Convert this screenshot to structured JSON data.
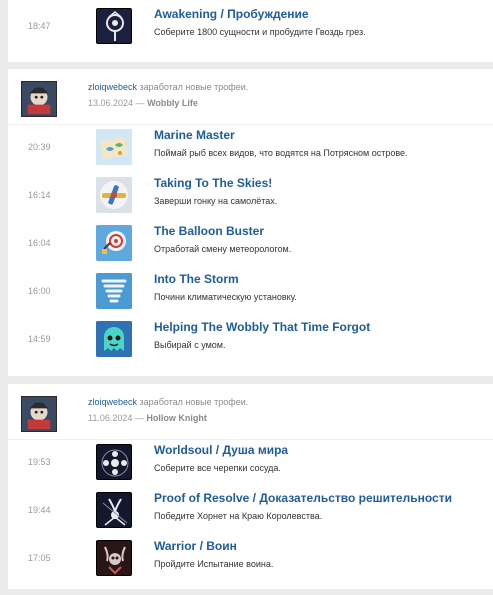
{
  "groups": [
    {
      "items": [
        {
          "time": "18:47",
          "title": "Awakening / Пробуждение",
          "description": "Соберите 1800 сущности и пробудите Гвоздь грез.",
          "icon": "awakening-trophy-icon"
        }
      ]
    },
    {
      "user": "zloiqwebeck",
      "action": "заработал новые трофеи.",
      "date": "13.06.2024",
      "dash": "—",
      "game": "Wobbly Life",
      "items": [
        {
          "time": "20:39",
          "title": "Marine Master",
          "description": "Поймай рыб всех видов, что водятся на Потрясном острове.",
          "icon": "fish-map-trophy-icon"
        },
        {
          "time": "16:14",
          "title": "Taking To The Skies!",
          "description": "Заверши гонку на самолётах.",
          "icon": "airplane-trophy-icon"
        },
        {
          "time": "16:04",
          "title": "The Balloon Buster",
          "description": "Отработай смену метеорологом.",
          "icon": "balloon-trophy-icon"
        },
        {
          "time": "16:00",
          "title": "Into The Storm",
          "description": "Почини климатическую установку.",
          "icon": "tornado-trophy-icon"
        },
        {
          "time": "14:59",
          "title": "Helping The Wobbly That Time Forgot",
          "description": "Выбирай с умом.",
          "icon": "ghost-wobbly-trophy-icon"
        }
      ]
    },
    {
      "user": "zloiqwebeck",
      "action": "заработал новые трофеи.",
      "date": "11.06.2024",
      "dash": "—",
      "game": "Hollow Knight",
      "items": [
        {
          "time": "19:53",
          "title": "Worldsoul / Душа мира",
          "description": "Соберите все черепки сосуда.",
          "icon": "worldsoul-trophy-icon"
        },
        {
          "time": "19:44",
          "title": "Proof of Resolve / Доказательство решительности",
          "description": "Победите Хорнет на Краю Королевства.",
          "icon": "hornet-trophy-icon"
        },
        {
          "time": "17:05",
          "title": "Warrior / Воин",
          "description": "Пройдите Испытание воина.",
          "icon": "warrior-trophy-icon"
        }
      ]
    }
  ]
}
